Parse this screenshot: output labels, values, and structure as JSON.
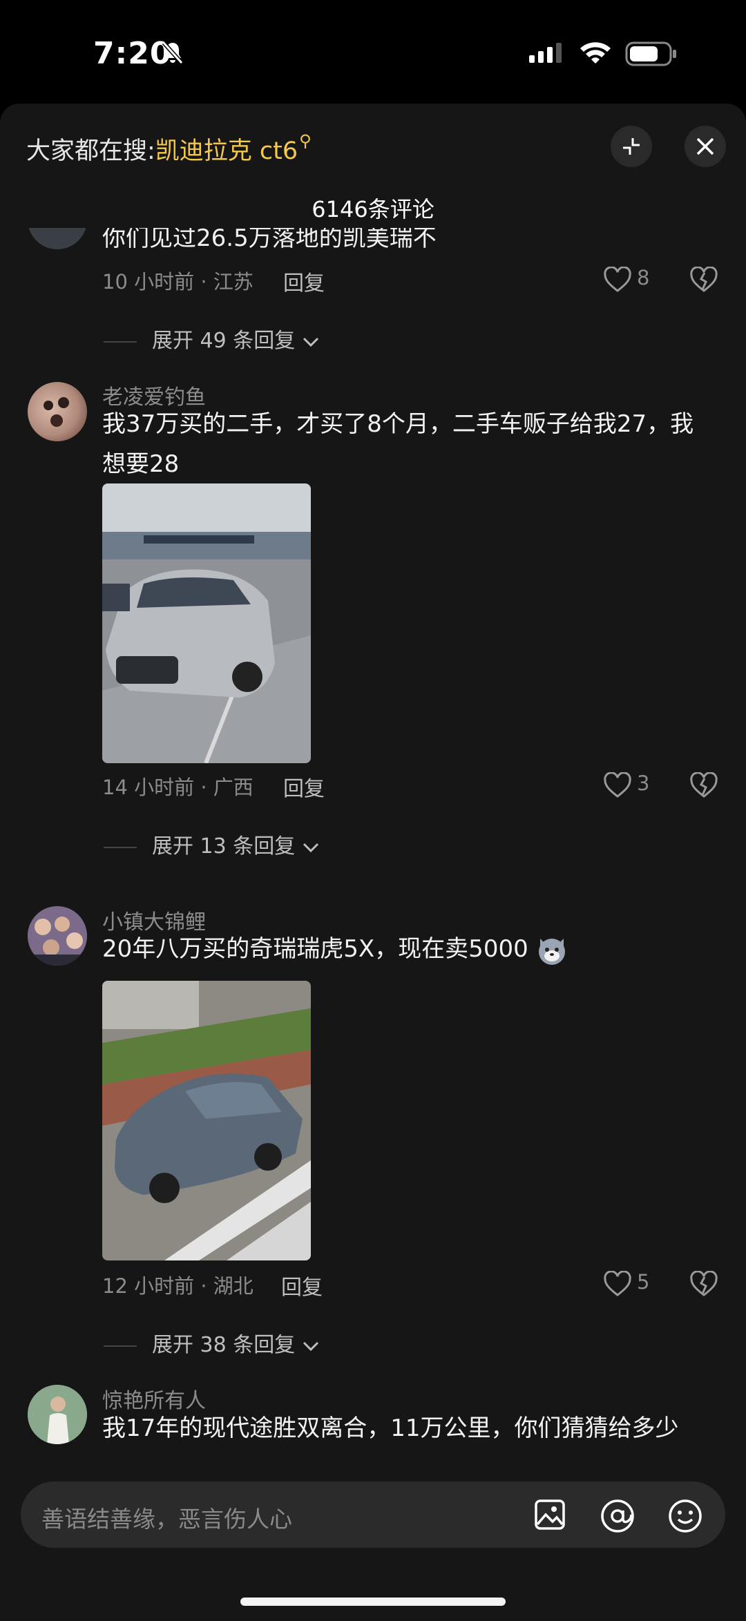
{
  "status": {
    "time": "7:20"
  },
  "header": {
    "search_prefix": "大家都在搜:",
    "search_keyword": "凯迪拉克 ct6",
    "comment_count": "6146条评论"
  },
  "comments": [
    {
      "text": "你们见过26.5万落地的凯美瑞不",
      "time_location": "10 小时前 · 江苏",
      "reply": "回复",
      "likes": "8",
      "expand": "展开 49 条回复"
    },
    {
      "user": "老凌爱钓鱼",
      "text": "我37万买的二手，才买了8个月，二手车贩子给我27，我想要28",
      "time_location": "14 小时前 · 广西",
      "reply": "回复",
      "likes": "3",
      "expand": "展开 13 条回复"
    },
    {
      "user": "小镇大锦鲤",
      "text": "20年八万买的奇瑞瑞虎5X，现在卖5000",
      "time_location": "12 小时前 · 湖北",
      "reply": "回复",
      "likes": "5",
      "expand": "展开 38 条回复"
    },
    {
      "user": "惊艳所有人",
      "text": "我17年的现代途胜双离合，11万公里，你们猜猜给多少"
    }
  ],
  "input": {
    "placeholder": "善语结善缘，恶言伤人心"
  }
}
